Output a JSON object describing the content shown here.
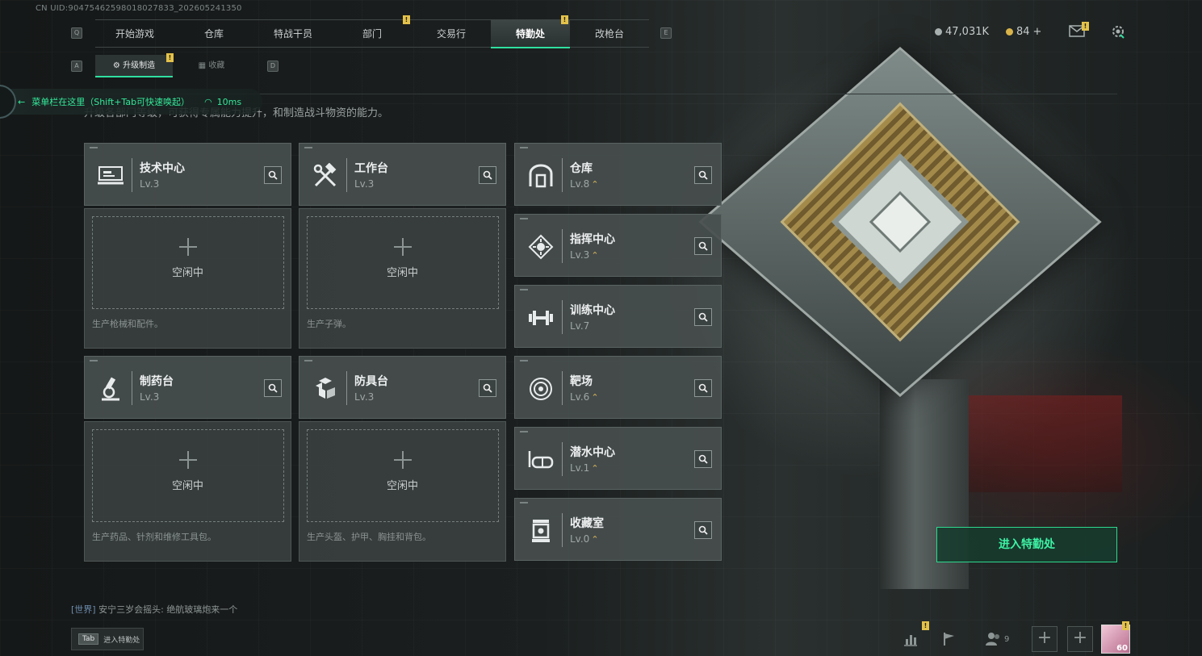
{
  "uid": "CN UID:9047546259801802783З_202605241350",
  "nav": {
    "left_key": "Q",
    "right_key": "E",
    "tabs": [
      {
        "label": "开始游戏"
      },
      {
        "label": "仓库"
      },
      {
        "label": "特战干员"
      },
      {
        "label": "部门"
      },
      {
        "label": "交易行"
      },
      {
        "label": "特勤处"
      },
      {
        "label": "改枪台"
      }
    ],
    "active_tab": "特勤处",
    "badge": "!"
  },
  "subnav": {
    "left_key": "A",
    "right_key": "D",
    "tabs": [
      {
        "label": "升级制造"
      },
      {
        "label": "收藏"
      }
    ]
  },
  "currency": {
    "silver": "47,031K",
    "gold": "84",
    "gold_add": "+"
  },
  "notice": {
    "text": "菜单栏在这里（Shift+Tab可快速唤起）",
    "ping": "10ms"
  },
  "intro": "升级各部门等级，可获得专属能力提升，和制造战斗物资的能力。",
  "stations": [
    {
      "name": "技术中心",
      "level": "Lv.3",
      "idle": "空闲中",
      "desc": "生产枪械和配件。"
    },
    {
      "name": "工作台",
      "level": "Lv.3",
      "idle": "空闲中",
      "desc": "生产子弹。"
    },
    {
      "name": "制药台",
      "level": "Lv.3",
      "idle": "空闲中",
      "desc": "生产药品、针剂和维修工具包。"
    },
    {
      "name": "防具台",
      "level": "Lv.3",
      "idle": "空闲中",
      "desc": "生产头盔、护甲、胸挂和背包。"
    }
  ],
  "facilities": [
    {
      "name": "仓库",
      "level": "Lv.8"
    },
    {
      "name": "指挥中心",
      "level": "Lv.3"
    },
    {
      "name": "训练中心",
      "level": "Lv.7"
    },
    {
      "name": "靶场",
      "level": "Lv.6"
    },
    {
      "name": "潜水中心",
      "level": "Lv.1"
    },
    {
      "name": "收藏室",
      "level": "Lv.0"
    }
  ],
  "enter_button": "进入特勤处",
  "chat": {
    "channel": "[世界]",
    "sender": "安宁三岁会摇头:",
    "message": "绝航玻璃炮来一个"
  },
  "tab_hint": {
    "key": "Tab",
    "label": "进入特勤处"
  },
  "friends_count": "9",
  "avatar_level": "60",
  "colors": {
    "accent": "#2fe0a0",
    "badge": "#e3c24b"
  }
}
